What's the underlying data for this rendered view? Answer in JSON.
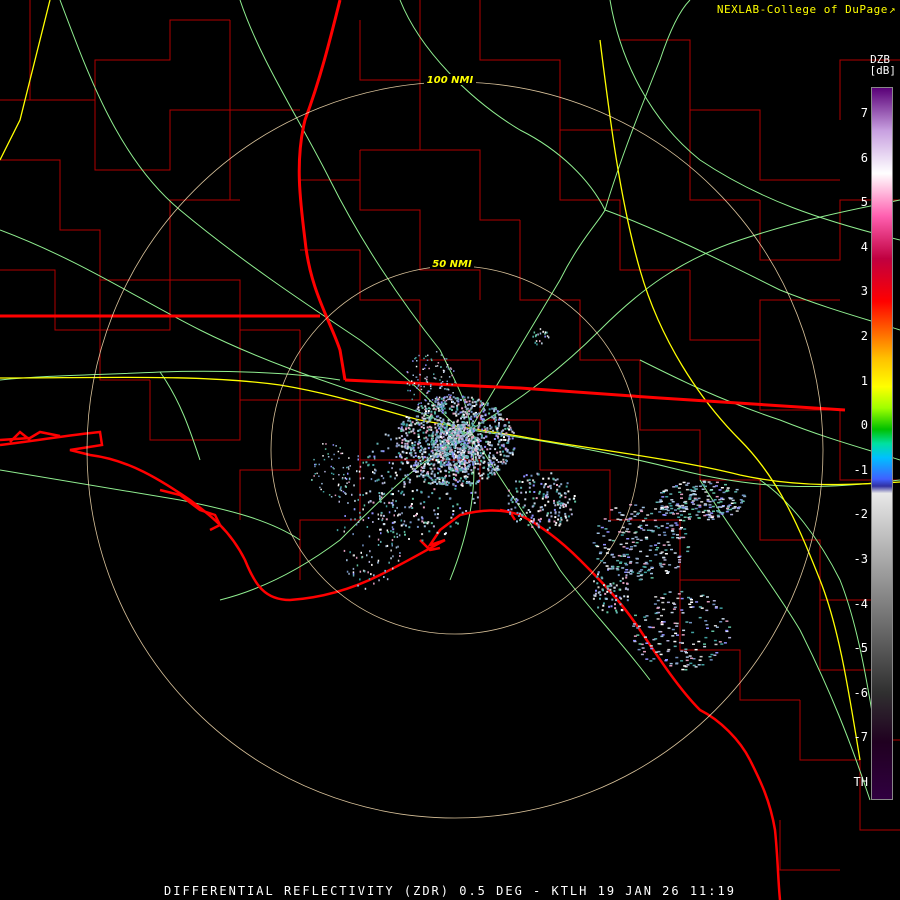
{
  "credit": "NEXLAB-College of DuPage",
  "credit_icon": "external-link-icon",
  "colorbar": {
    "product": "DZB",
    "units": "[dB]",
    "ticks": [
      "7",
      "6",
      "5",
      "4",
      "3",
      "2",
      "1",
      "0",
      "-1",
      "-2",
      "-3",
      "-4",
      "-5",
      "-6",
      "-7",
      "TH"
    ]
  },
  "range_rings": [
    "100 NMI",
    "50 NMI"
  ],
  "footer": "DIFFERENTIAL REFLECTIVITY (ZDR) 0.5 DEG - KTLH 19 JAN 26 11:19",
  "colors": {
    "state_border": "#ff0000",
    "county_border": "#b40000",
    "highway": "#90ee90",
    "interstate": "#ffff00",
    "range_ring": "#ffe4b5",
    "text": "#ffffff"
  }
}
